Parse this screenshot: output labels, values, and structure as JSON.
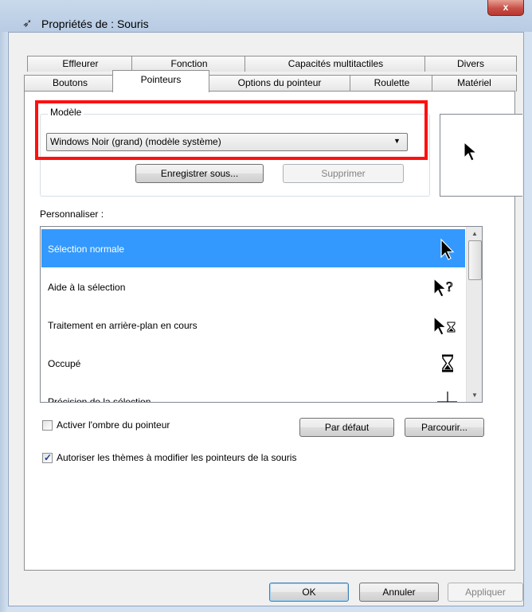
{
  "window": {
    "title": "Propriétés de : Souris",
    "close_glyph": "x"
  },
  "tabs_row1": [
    "Effleurer",
    "Fonction",
    "Capacités multitactiles",
    "Divers"
  ],
  "tabs_row2": [
    "Boutons",
    "Pointeurs",
    "Options du pointeur",
    "Roulette",
    "Matériel"
  ],
  "active_tab": "Pointeurs",
  "scheme": {
    "group_label": "Modèle",
    "selected": "Windows Noir (grand) (modèle système)",
    "save_as": "Enregistrer sous...",
    "delete": "Supprimer"
  },
  "customize": {
    "label": "Personnaliser :",
    "items": [
      {
        "label": "Sélection normale",
        "icon": "arrow-cursor-icon",
        "selected": true
      },
      {
        "label": "Aide à la sélection",
        "icon": "help-cursor-icon",
        "selected": false
      },
      {
        "label": "Traitement en arrière-plan en cours",
        "icon": "working-in-background-cursor-icon",
        "selected": false
      },
      {
        "label": "Occupé",
        "icon": "busy-hourglass-cursor-icon",
        "selected": false
      },
      {
        "label": "Précision de la sélection",
        "icon": "crosshair-cursor-icon",
        "selected": false
      }
    ]
  },
  "options": {
    "shadow": {
      "label": "Activer l'ombre du pointeur",
      "checked": false
    },
    "themes": {
      "label": "Autoriser les thèmes à modifier les pointeurs de la souris",
      "checked": true
    },
    "use_default": "Par défaut",
    "browse": "Parcourir..."
  },
  "footer": {
    "ok": "OK",
    "cancel": "Annuler",
    "apply": "Appliquer"
  },
  "colors": {
    "selection": "#3399ff",
    "highlight_box": "#ff1010"
  }
}
